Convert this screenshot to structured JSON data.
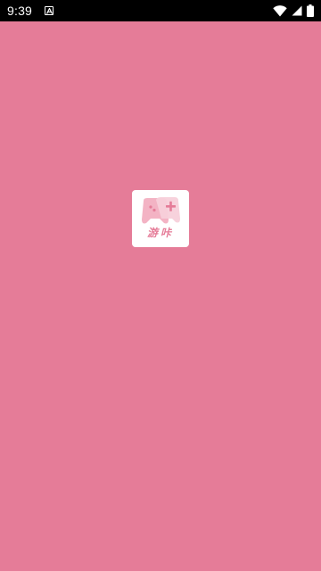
{
  "status_bar": {
    "time": "9:39",
    "notification_icon": "a-letter-icon",
    "wifi_icon": "wifi-icon",
    "signal_icon": "signal-icon",
    "battery_icon": "battery-icon"
  },
  "splash": {
    "app_icon": "gamepad-icon",
    "app_label": "游咔"
  },
  "colors": {
    "background": "#e57c98",
    "status_bar": "#000000",
    "icon_tile": "#ffffff",
    "accent": "#e57c98"
  }
}
